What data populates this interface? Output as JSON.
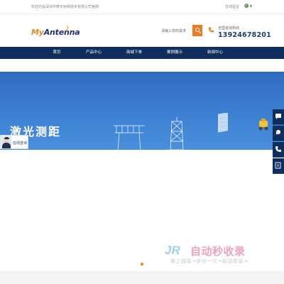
{
  "topbar": {
    "welcome": "欢迎光临深圳市摩天射频技术有限公司官网",
    "online_message": "在线留言"
  },
  "header": {
    "logo_my": "My",
    "logo_rest": "Antenna",
    "search_placeholder": "请输入您的需求",
    "hotline_label": "全国咨询热线",
    "hotline_number": "13924678201"
  },
  "nav": {
    "items": [
      {
        "label": "首页"
      },
      {
        "label": "产品中心"
      },
      {
        "label": "商城下单"
      },
      {
        "label": "案例展示"
      },
      {
        "label": "新闻中心"
      }
    ]
  },
  "banner": {
    "title": "激光测距"
  },
  "consult": {
    "label": "在线咨询"
  },
  "watermark": {
    "logo": "JR",
    "text": "自动秒收录",
    "sub": "做上链接→来访一次→自动收录→"
  },
  "colors": {
    "nav_bg": "#0e2f5d",
    "accent": "#ea7d23",
    "banner_blue": "#3a7dd0"
  },
  "icons": [
    "search-icon",
    "phone-icon",
    "globe-flag-icon",
    "chat-icon",
    "message-icon",
    "phone-side-icon",
    "edit-icon"
  ]
}
